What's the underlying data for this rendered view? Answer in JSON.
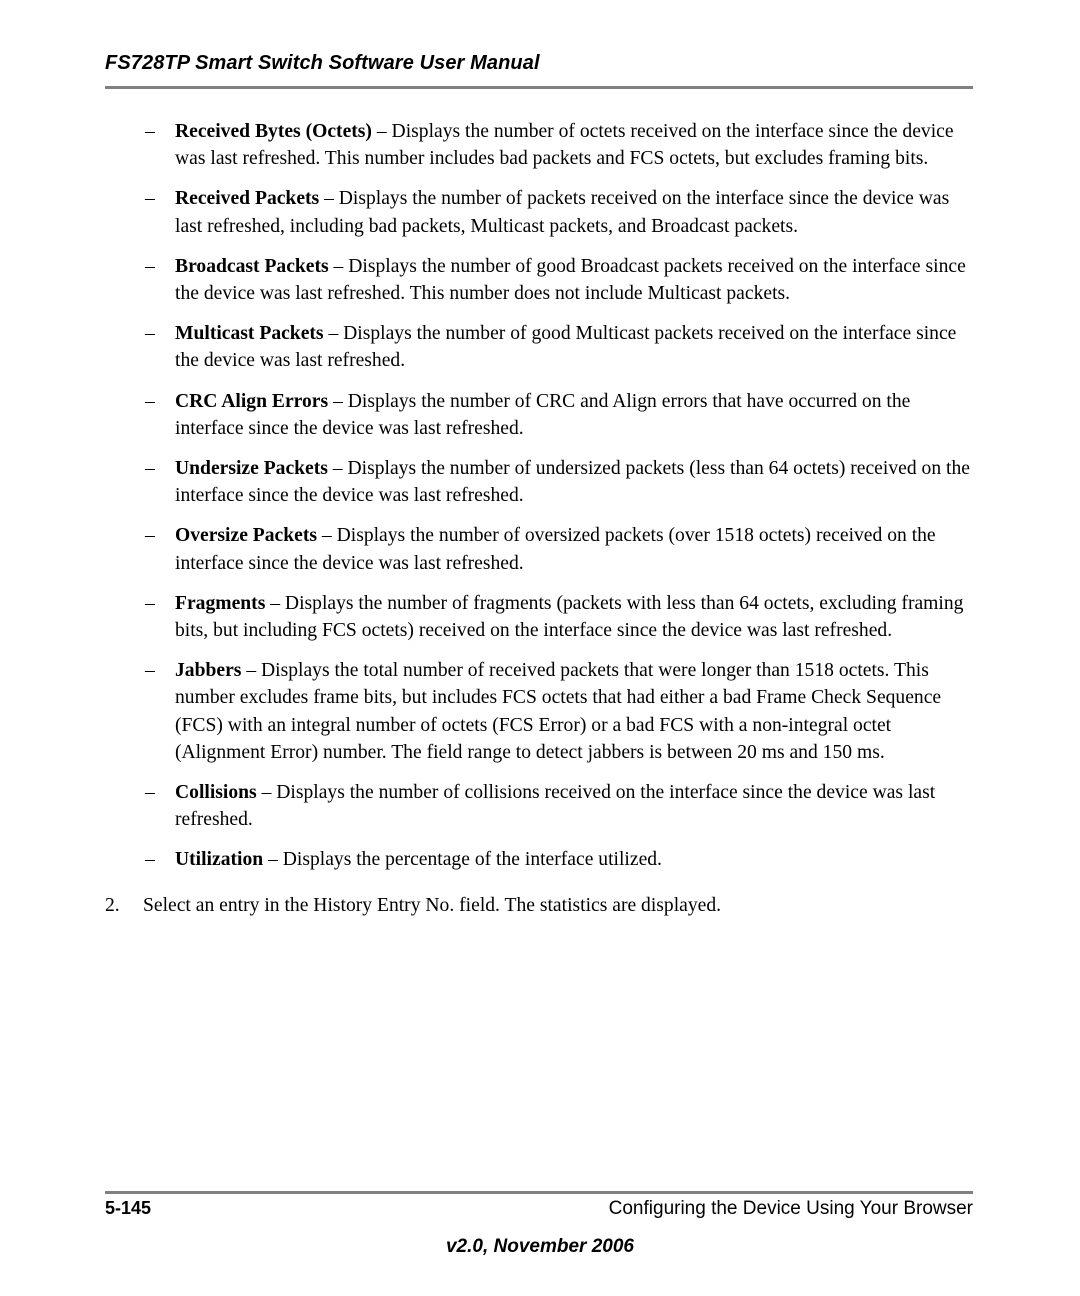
{
  "header": {
    "title": "FS728TP Smart Switch Software User Manual"
  },
  "content": {
    "bullet_marker": "–",
    "items": [
      {
        "term": "Received Bytes (Octets)",
        "separator": " – ",
        "description": "Displays the number of octets received on the interface since the device was last refreshed. This number includes bad packets and FCS octets, but excludes framing bits."
      },
      {
        "term": "Received Packets",
        "separator": " – ",
        "description": "Displays the number of packets received on the interface since the device was last refreshed, including bad packets, Multicast packets, and Broadcast packets."
      },
      {
        "term": "Broadcast Packets",
        "separator": " – ",
        "description": "Displays the number of good Broadcast packets received on the interface since the device was last refreshed. This number does not include Multicast packets."
      },
      {
        "term": "Multicast Packets",
        "separator": " – ",
        "description": "Displays the number of good Multicast packets received on the interface since the device was last refreshed."
      },
      {
        "term": "CRC Align Errors",
        "separator": " – ",
        "description": "Displays the number of CRC and Align errors that have occurred on the interface since the device was last refreshed."
      },
      {
        "term": "Undersize Packets",
        "separator": " – ",
        "description": "Displays the number of undersized packets (less than 64 octets) received on the interface since the device was last refreshed."
      },
      {
        "term": "Oversize Packets",
        "separator": " – ",
        "description": "Displays the number of oversized packets (over 1518 octets) received on the interface since the device was last refreshed."
      },
      {
        "term": "Fragments",
        "separator": " – ",
        "description": "Displays the number of fragments (packets with less than 64 octets, excluding framing bits, but including FCS octets) received on the interface since the device was last refreshed."
      },
      {
        "term": "Jabbers",
        "separator": " – ",
        "description": "Displays the total number of received packets that were longer than 1518 octets. This number excludes frame bits, but includes FCS octets that had either a bad Frame Check Sequence (FCS) with an integral number of octets (FCS Error) or a bad FCS with a non-integral octet (Alignment Error) number. The field range to detect jabbers is between 20 ms and 150 ms."
      },
      {
        "term": "Collisions",
        "separator": " – ",
        "description": "Displays the number of collisions received on the interface since the device was last refreshed."
      },
      {
        "term": "Utilization",
        "separator": " – ",
        "description": "Displays the percentage of the interface utilized."
      }
    ],
    "numbered_step": {
      "marker": "2.",
      "text": "Select an entry in the History Entry No. field. The statistics are displayed."
    }
  },
  "footer": {
    "page_number": "5-145",
    "section": "Configuring the Device Using Your Browser",
    "version": "v2.0, November 2006"
  },
  "colors": {
    "rule": "#808080",
    "text": "#000000",
    "background": "#ffffff"
  }
}
